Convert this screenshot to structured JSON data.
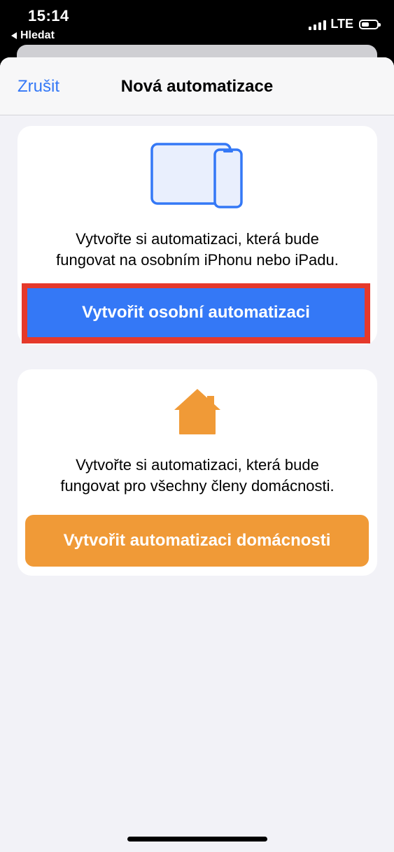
{
  "status_bar": {
    "time": "15:14",
    "back_label": "Hledat",
    "network": "LTE"
  },
  "navbar": {
    "cancel_label": "Zrušit",
    "title": "Nová automatizace"
  },
  "personal_card": {
    "icon": "ipad-iphone-icon",
    "description_line1": "Vytvořte si automatizaci, která bude",
    "description_line2": "fungovat na osobním iPhonu nebo iPadu.",
    "button_label": "Vytvořit osobní automatizaci"
  },
  "home_card": {
    "icon": "home-icon",
    "description_line1": "Vytvořte si automatizaci, která bude",
    "description_line2": "fungovat pro všechny členy domácnosti.",
    "button_label": "Vytvořit automatizaci domácnosti"
  },
  "colors": {
    "accent_blue": "#3478f6",
    "home_orange": "#f09a37",
    "highlight_red": "#e5392b",
    "background": "#f2f2f7"
  }
}
